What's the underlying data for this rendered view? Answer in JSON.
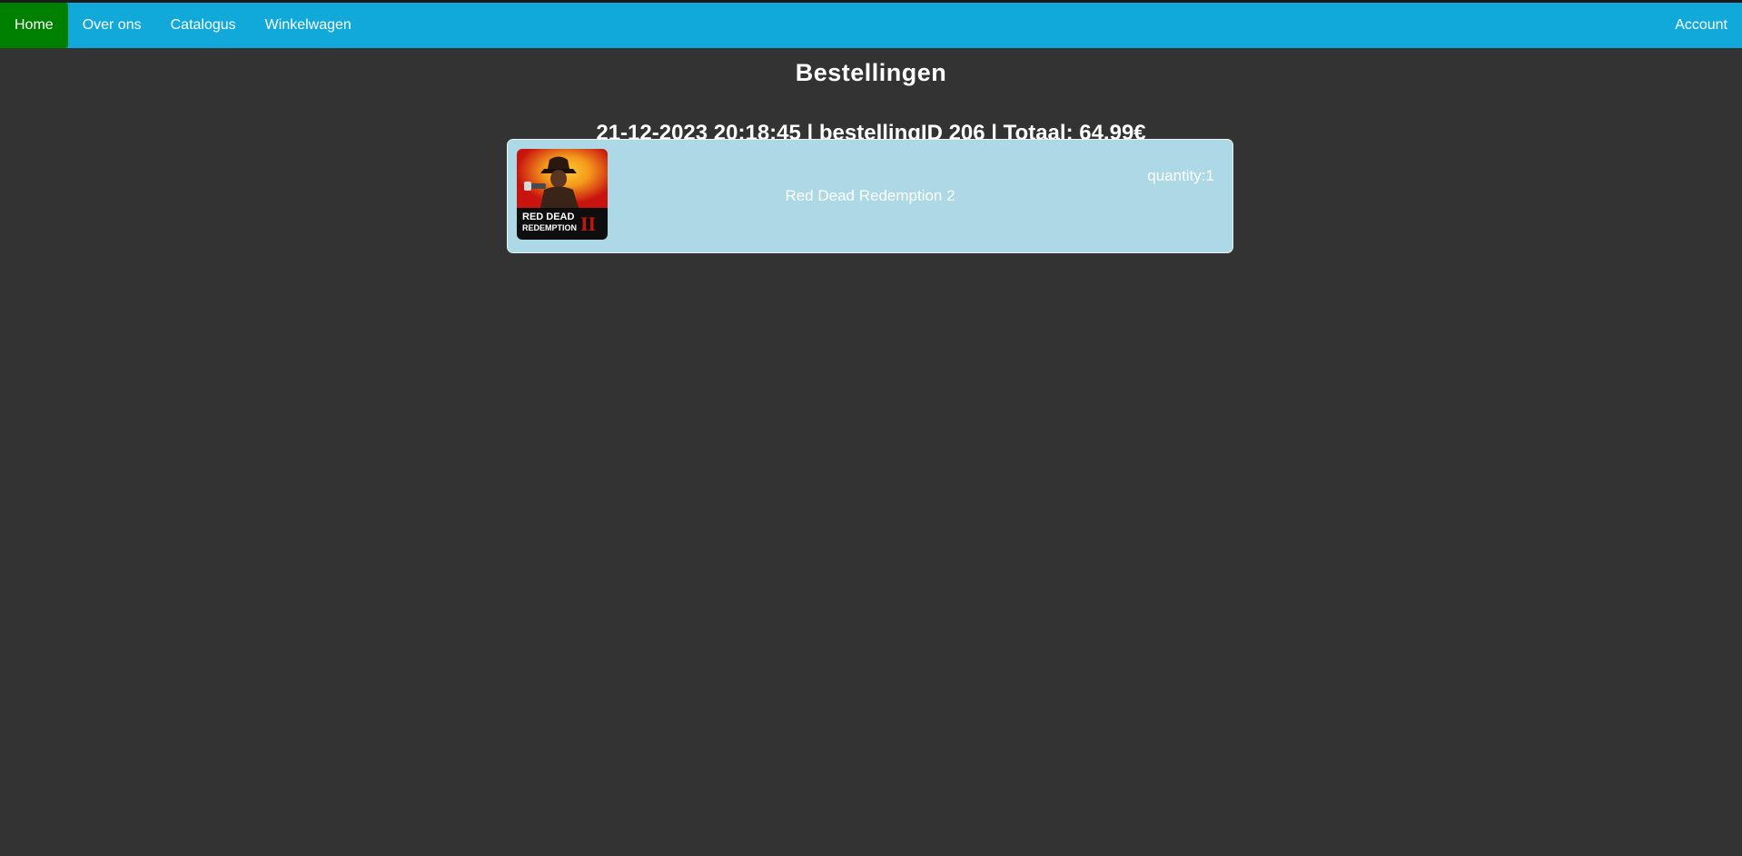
{
  "nav": {
    "items": [
      {
        "label": "Home",
        "active": true
      },
      {
        "label": "Over ons",
        "active": false
      },
      {
        "label": "Catalogus",
        "active": false
      },
      {
        "label": "Winkelwagen",
        "active": false
      }
    ],
    "account_label": "Account"
  },
  "page": {
    "title": "Bestellingen"
  },
  "order": {
    "header": "21-12-2023 20:18:45 | bestellingID 206 | Totaal: 64.99€",
    "items": [
      {
        "name": "Red Dead Redemption 2",
        "quantity_label": "quantity:1",
        "image_icon": "red-dead-redemption-2-cover"
      }
    ]
  },
  "colors": {
    "background": "#333333",
    "navbar": "#11a9da",
    "active_nav": "#008000",
    "card": "#add8e6"
  }
}
